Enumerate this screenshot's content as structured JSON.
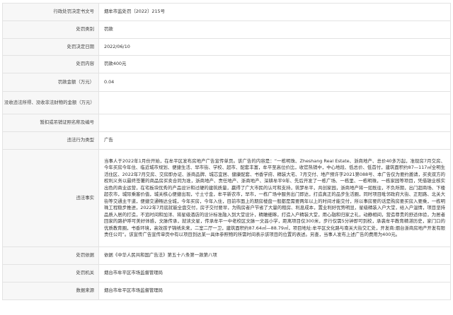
{
  "rows": [
    {
      "label": "行政处罚决定书文号",
      "value": "烟牟市监处罚〔2022〕215号"
    },
    {
      "label": "处罚类别",
      "value": "罚款"
    },
    {
      "label": "处罚决定日期",
      "value": "2022/06/10"
    },
    {
      "label": "处罚内容",
      "value": "罚款400元"
    },
    {
      "label": "罚款金额（万元）",
      "value": "0.04"
    },
    {
      "label": "没收违法所得、没收非法财物的金额（万元）",
      "value": ""
    },
    {
      "label": "暂扣或吊销证照名称及编号",
      "value": ""
    },
    {
      "label": "违法行为类型",
      "value": "广告"
    },
    {
      "label": "违法事实",
      "value": "当事人于2022年1月份开始，在牟平区发布房地产广告宣传单页。该广告的内容是：“一栋明珠、Zheshang Real Estate、浙商地产、总价40多万起，准现房7月交房、今年买房今年住、临近城市规划、便捷生活、早市街、学校、超市、配套丰富，牟平至高位价比，收官热销中，中心地段、低总价、低首付，建筑面积约87—117㎡全明生活住区、2022年7月交房、交房即办证、浙商品牌、城芯宜居、健康配套、书香学府、精装大宅、7月交付、地产预许字2021第088号、本广告仅为要约邀请，买卖双方的权利义务以最终签署的商品房买卖合同为准，浙商地产、责任地产、浙商地产、深耕牟平9年、先后开发了一栋广场、一栋里、一栋明珠，一栋家园等项目，凭借雄业核实出色的商业运营，在宅板块优秀的产品设计和过硬的建筑质量，赢得了广大市民的认可和支持，筑梦牟平，共创家园，浙商地产将一如既往，不负所期，出门超商场、下楼超农市，城际乘客价值，城关核心便捷出现，寸土寸金，牟平新农市，早市，一栋广场中服务出门即达，打造真正的品步生活圈，同时项目毗邻政府大街、正阳路、北关大街等交通主干道，便捷交通畅达全城，今年买房，今年入住，目前市面上的期房楼盘一般都是需要两年以上的时间才能交付，所以事房要的话是购房要买房入要乘，一栋明珠工程稳步推进，2022年7月底就能全盘交付，房子交付要早，为购房者户节省了大量的租房、利息成本，置业利好优势明显，星级精装入户大堂，给入户温情，项目坚持品质入居的打造，不追时间和加洋、将星级酒店的设计标准融入到大堂设计，精雕细琢，打造入户精装大堂，用心融和归家之礼，动静相间，营造尊贵的舒适体验，为居者回家的路护呼可美好体感，文脉传承，就读文星，传承牟平一中老校区文脉一文昌小学，距离项目仅300米，步行仅需5分钟即可到校，承袭牟平教育精湛历史，家门口的优质教育圈，书香环境，高效孩子锦绣未来，二室二厅一卫，建筑面积约87.64㎡—88.79㎡，项目地址:牟平区文化路与南关大街交汇处，开发商:烟台浙商房地产开发有限责任公司”。该宣传广告宣传单页中有以项目到达某一具体参照物的所需时间表示该项目的位置的表述。另查，当事人发布上述广告的费用为400元。"
    },
    {
      "label": "处罚依据",
      "value": "依据《中华人民共和国广告法》第五十八条第一款第八项"
    },
    {
      "label": "处罚机关",
      "value": "烟台市牟平区市场监督管理局"
    },
    {
      "label": "数据来源",
      "value": "烟台市牟平区市场监督管理局"
    }
  ]
}
